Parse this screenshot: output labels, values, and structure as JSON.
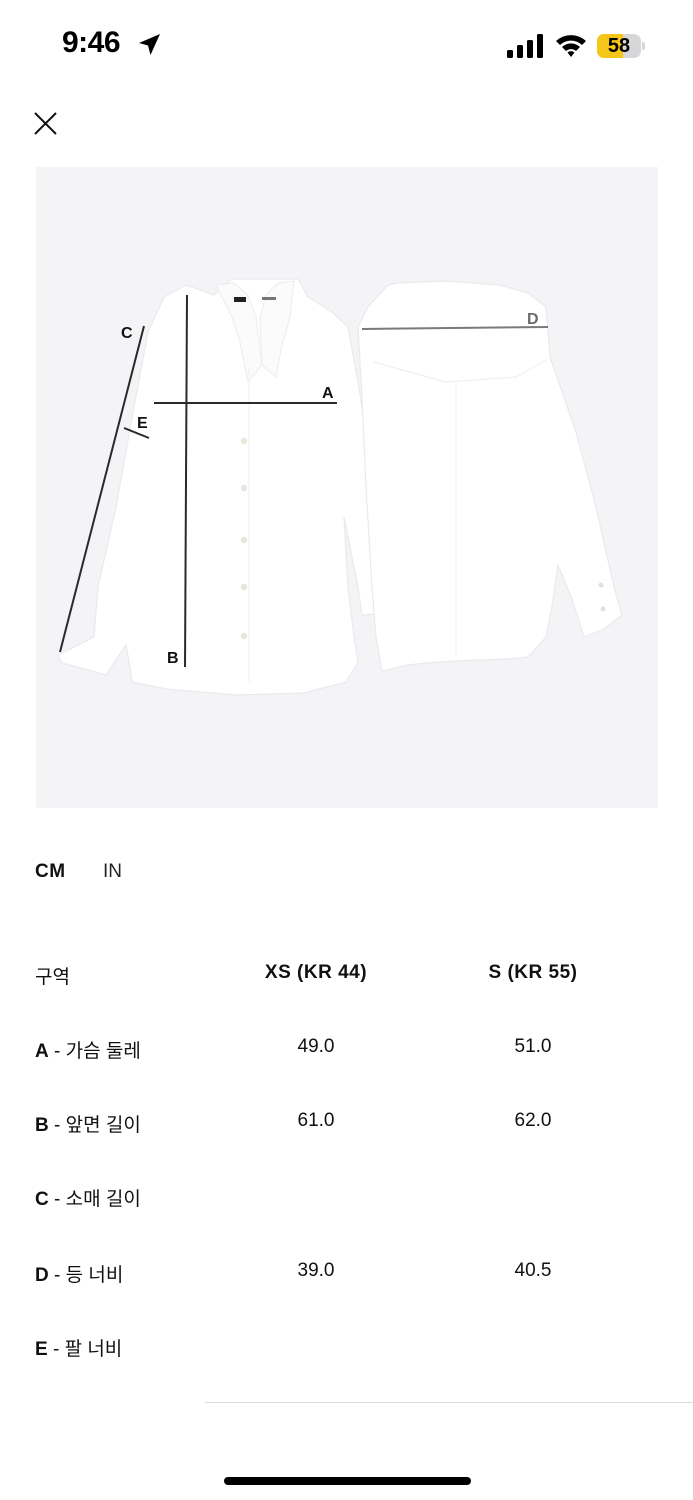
{
  "status_bar": {
    "time": "9:46",
    "battery_level": "58",
    "battery_fraction": 0.58,
    "icons": [
      "location-arrow-icon",
      "cellular-signal-icon",
      "wifi-icon",
      "battery-icon"
    ]
  },
  "header": {
    "close_icon": "close-icon"
  },
  "figure": {
    "labels": {
      "a": "A",
      "b": "B",
      "c": "C",
      "d": "D",
      "e": "E"
    }
  },
  "units": {
    "cm": "CM",
    "in": "IN",
    "selected": "CM"
  },
  "table": {
    "headers": [
      "구역",
      "XS (KR 44)",
      "S (KR 55)"
    ],
    "rows": [
      {
        "key": "A",
        "label": " - 가슴 둘레",
        "xs": "49.0",
        "s": "51.0"
      },
      {
        "key": "B",
        "label": " - 앞면 길이",
        "xs": "61.0",
        "s": "62.0"
      },
      {
        "key": "C",
        "label": " - 소매 길이",
        "xs": "",
        "s": ""
      },
      {
        "key": "D",
        "label": " - 등 너비",
        "xs": "39.0",
        "s": "40.5"
      },
      {
        "key": "E",
        "label": " - 팔 너비",
        "xs": "",
        "s": ""
      }
    ]
  },
  "colors": {
    "battery": "#f5c518",
    "image_bg": "#f4f4f7",
    "text": "#111111"
  }
}
